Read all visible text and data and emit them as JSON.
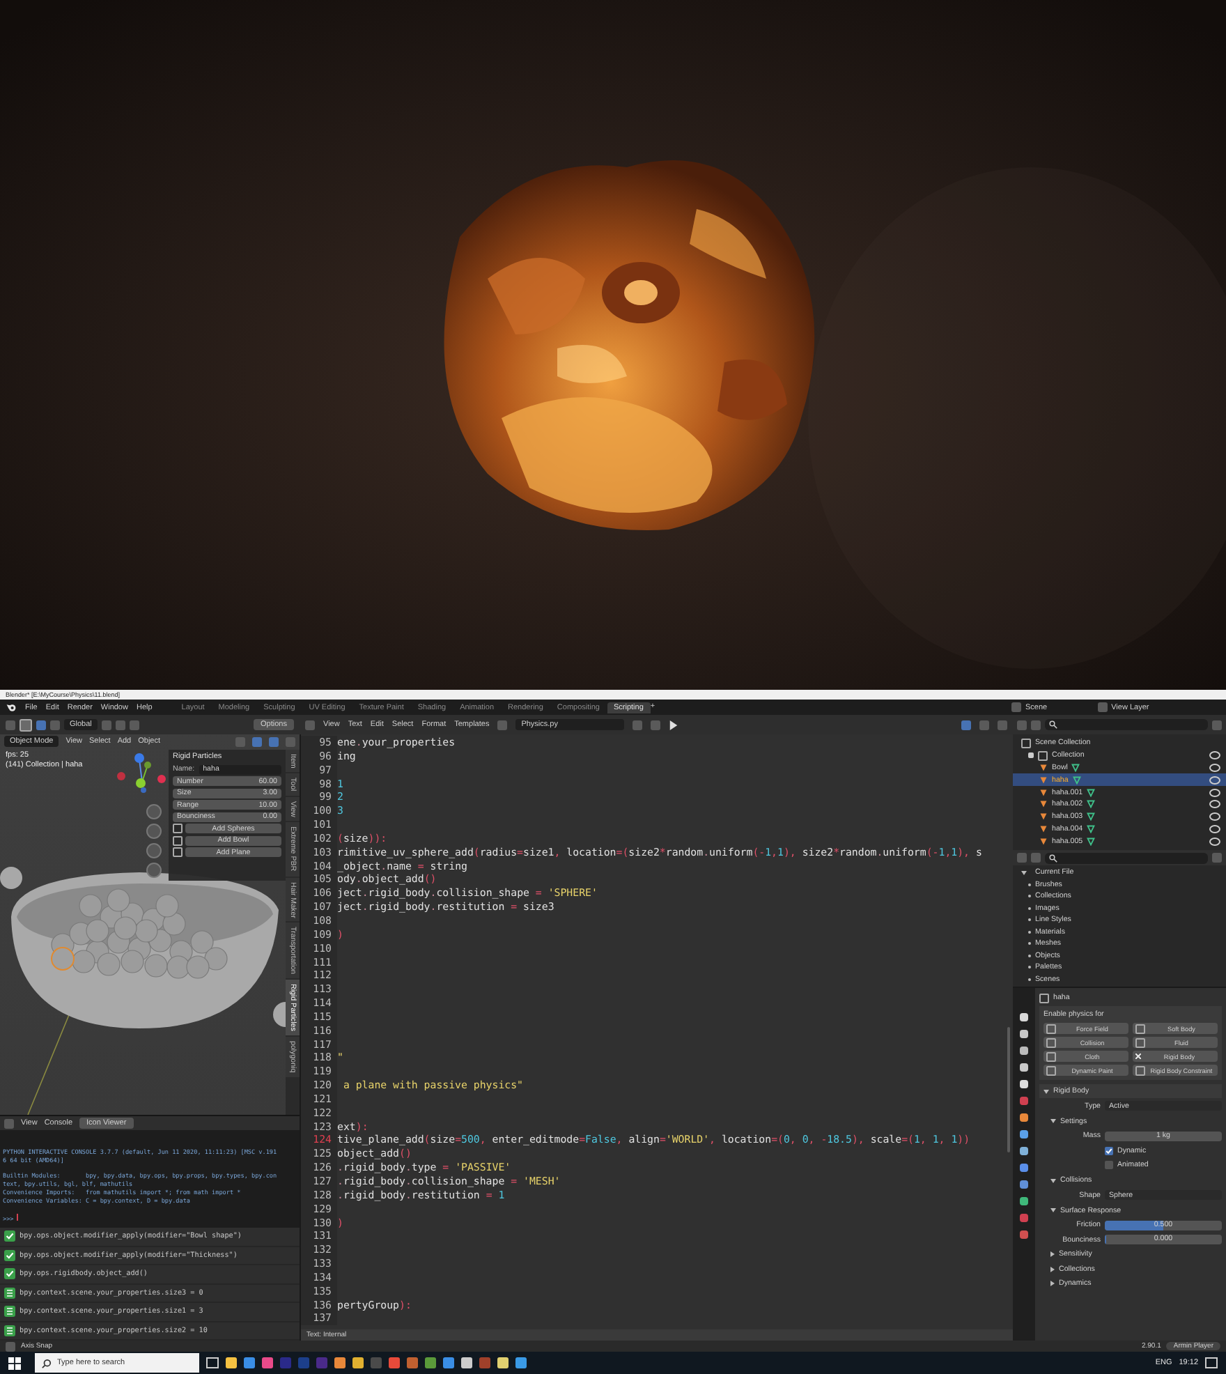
{
  "title_bar": {
    "title": "Blender* [E:\\MyCourse\\Physics\\11.blend]"
  },
  "menu_bar": {
    "menus": [
      "File",
      "Edit",
      "Render",
      "Window",
      "Help"
    ],
    "workspaces": [
      {
        "label": "Layout",
        "selected": false
      },
      {
        "label": "Modeling",
        "selected": false
      },
      {
        "label": "Sculpting",
        "selected": false
      },
      {
        "label": "UV Editing",
        "selected": false
      },
      {
        "label": "Texture Paint",
        "selected": false
      },
      {
        "label": "Shading",
        "selected": false
      },
      {
        "label": "Animation",
        "selected": false
      },
      {
        "label": "Rendering",
        "selected": false
      },
      {
        "label": "Compositing",
        "selected": false
      },
      {
        "label": "Scripting",
        "selected": true
      }
    ],
    "add_tab": "+",
    "scene": "Scene",
    "view_layer": "View Layer"
  },
  "tool_header": {
    "orientation": "Global",
    "options": "Options"
  },
  "viewport": {
    "mode": "Object Mode",
    "menus": [
      "View",
      "Select",
      "Add",
      "Object"
    ],
    "fps": "fps: 25",
    "info": "(141) Collection | haha",
    "panel": {
      "title": "Rigid Particles",
      "name_label": "Name:",
      "name_value": "haha",
      "fields": [
        {
          "label": "Number",
          "value": "60.00"
        },
        {
          "label": "Size",
          "value": "3.00"
        },
        {
          "label": "Range",
          "value": "10.00"
        },
        {
          "label": "Bounciness",
          "value": "0.00"
        }
      ],
      "buttons": [
        "Add Spheres",
        "Add Bowl",
        "Add Plane"
      ]
    },
    "sidebar_tabs": [
      {
        "label": "Item",
        "selected": false
      },
      {
        "label": "Tool",
        "selected": false
      },
      {
        "label": "View",
        "selected": false
      },
      {
        "label": "Extreme PBR",
        "selected": false
      },
      {
        "label": "Hair Maker",
        "selected": false
      },
      {
        "label": "Transportation",
        "selected": false
      },
      {
        "label": "Rigid Particles",
        "selected": true
      },
      {
        "label": "polygoniq",
        "selected": false
      }
    ]
  },
  "console": {
    "menus": [
      "View",
      "Console"
    ],
    "button": "Icon Viewer",
    "output": [
      "PYTHON INTERACTIVE CONSOLE 3.7.7 (default, Jun 11 2020, 11:11:23) [MSC v.191",
      "6 64 bit (AMD64)]",
      "Builtin Modules:       bpy, bpy.data, bpy.ops, bpy.props, bpy.types, bpy.con",
      "text, bpy.utils, bgl, blf, mathutils",
      "Convenience Imports:   from mathutils import *; from math import *",
      "Convenience Variables: C = bpy.context, D = bpy.data"
    ],
    "prompt": ">>>",
    "history": [
      {
        "kind": "operator",
        "text": "bpy.ops.object.modifier_apply(modifier=\"Bowl shape\")"
      },
      {
        "kind": "operator",
        "text": "bpy.ops.object.modifier_apply(modifier=\"Thickness\")"
      },
      {
        "kind": "operator",
        "text": "bpy.ops.rigidbody.object_add()"
      },
      {
        "kind": "property",
        "text": "bpy.context.scene.your_properties.size3 = 0"
      },
      {
        "kind": "property",
        "text": "bpy.context.scene.your_properties.size1 = 3"
      },
      {
        "kind": "property",
        "text": "bpy.context.scene.your_properties.size2 = 10"
      }
    ]
  },
  "text_editor": {
    "menus": [
      "View",
      "Text",
      "Edit",
      "Select",
      "Format",
      "Templates"
    ],
    "file": "Physics.py",
    "footer": "Text: Internal",
    "lines": [
      {
        "number": "95",
        "kind": "code",
        "current": false,
        "text": "ene.your_properties"
      },
      {
        "number": "96",
        "kind": "code",
        "current": false,
        "text": "ing"
      },
      {
        "number": "97",
        "kind": "code",
        "current": false
      },
      {
        "number": "98",
        "kind": "code",
        "current": false,
        "text": "1"
      },
      {
        "number": "99",
        "kind": "code",
        "current": false,
        "text": "2"
      },
      {
        "number": "100",
        "kind": "code",
        "current": false,
        "text": "3"
      },
      {
        "number": "101",
        "kind": "code",
        "current": false
      },
      {
        "number": "102",
        "kind": "code",
        "current": false,
        "text": "(size)):"
      },
      {
        "number": "103",
        "kind": "code",
        "current": false,
        "text": "rimitive_uv_sphere_add(radius=size1, location=(size2*random.uniform(-1,1), size2*random.uniform(-1,1), s"
      },
      {
        "number": "104",
        "kind": "code",
        "current": false,
        "text": "_object.name = string"
      },
      {
        "number": "105",
        "kind": "code",
        "current": false,
        "text": "ody.object_add()"
      },
      {
        "number": "106",
        "kind": "code",
        "current": false,
        "text": "ject.rigid_body.collision_shape = 'SPHERE'"
      },
      {
        "number": "107",
        "kind": "code",
        "current": false,
        "text": "ject.rigid_body.restitution = size3"
      },
      {
        "number": "108",
        "kind": "code",
        "current": false
      },
      {
        "number": "109",
        "kind": "code",
        "current": false,
        "text": ")"
      },
      {
        "number": "110",
        "kind": "code",
        "current": false
      },
      {
        "number": "111",
        "kind": "code",
        "current": false
      },
      {
        "number": "112",
        "kind": "code",
        "current": false
      },
      {
        "number": "113",
        "kind": "code",
        "current": false
      },
      {
        "number": "114",
        "kind": "code",
        "current": false
      },
      {
        "number": "115",
        "kind": "code",
        "current": false
      },
      {
        "number": "116",
        "kind": "code",
        "current": false
      },
      {
        "number": "117",
        "kind": "code",
        "current": false
      },
      {
        "number": "118",
        "kind": "string",
        "current": false,
        "text": "\""
      },
      {
        "number": "119",
        "kind": "code",
        "current": false
      },
      {
        "number": "120",
        "kind": "string",
        "current": false,
        "text": " a plane with passive physics\""
      },
      {
        "number": "121",
        "kind": "code",
        "current": false
      },
      {
        "number": "122",
        "kind": "code",
        "current": false
      },
      {
        "number": "123",
        "kind": "code",
        "current": false,
        "text": "ext):"
      },
      {
        "number": "124",
        "kind": "code",
        "current": true,
        "text": "tive_plane_add(size=500, enter_editmode=False, align='WORLD', location=(0, 0, -18.5), scale=(1, 1, 1))"
      },
      {
        "number": "125",
        "kind": "code",
        "current": false,
        "text": "object_add()"
      },
      {
        "number": "126",
        "kind": "code",
        "current": false,
        "text": ".rigid_body.type = 'PASSIVE'"
      },
      {
        "number": "127",
        "kind": "code",
        "current": false,
        "text": ".rigid_body.collision_shape = 'MESH'"
      },
      {
        "number": "128",
        "kind": "code",
        "current": false,
        "text": ".rigid_body.restitution = 1"
      },
      {
        "number": "129",
        "kind": "code",
        "current": false
      },
      {
        "number": "130",
        "kind": "code",
        "current": false,
        "text": ")"
      },
      {
        "number": "131",
        "kind": "code",
        "current": false
      },
      {
        "number": "132",
        "kind": "code",
        "current": false
      },
      {
        "number": "133",
        "kind": "code",
        "current": false
      },
      {
        "number": "134",
        "kind": "code",
        "current": false
      },
      {
        "number": "135",
        "kind": "code",
        "current": false
      },
      {
        "number": "136",
        "kind": "code",
        "current": false,
        "text": "pertyGroup):"
      },
      {
        "number": "137",
        "kind": "code",
        "current": false
      }
    ]
  },
  "outliner": {
    "root": "Scene Collection",
    "collection": "Collection",
    "items": [
      {
        "name": "Bowl",
        "selected": false
      },
      {
        "name": "haha",
        "selected": true
      },
      {
        "name": "haha.001",
        "selected": false
      },
      {
        "name": "haha.002",
        "selected": false
      },
      {
        "name": "haha.003",
        "selected": false
      },
      {
        "name": "haha.004",
        "selected": false
      },
      {
        "name": "haha.005",
        "selected": false
      }
    ]
  },
  "data_outliner": {
    "root": "Current File",
    "items": [
      "Brushes",
      "Collections",
      "Images",
      "Line Styles",
      "Materials",
      "Meshes",
      "Objects",
      "Palettes",
      "Scenes"
    ]
  },
  "properties": {
    "object": "haha",
    "physics_label": "Enable physics for",
    "physics_buttons": [
      {
        "label": "Force Field",
        "enabled": false
      },
      {
        "label": "Soft Body",
        "enabled": false
      },
      {
        "label": "Collision",
        "enabled": false
      },
      {
        "label": "Fluid",
        "enabled": false
      },
      {
        "label": "Cloth",
        "enabled": false
      },
      {
        "label": "Rigid Body",
        "enabled": true
      },
      {
        "label": "Dynamic Paint",
        "enabled": false
      },
      {
        "label": "Rigid Body Constraint",
        "enabled": false
      }
    ],
    "panel": "Rigid Body",
    "type_label": "Type",
    "type_value": "Active",
    "settings": "Settings",
    "mass_label": "Mass",
    "mass_value": "1 kg",
    "checks": [
      {
        "label": "Dynamic",
        "checked": true
      },
      {
        "label": "Animated",
        "checked": false
      }
    ],
    "collisions": "Collisions",
    "shape_label": "Shape",
    "shape_value": "Sphere",
    "surface": "Surface Response",
    "sliders": [
      {
        "label": "Friction",
        "value": "0.500",
        "level": 0.5
      },
      {
        "label": "Bounciness",
        "value": "0.000",
        "level": 0
      }
    ],
    "closed_panels": [
      "Sensitivity",
      "Collections",
      "Dynamics"
    ]
  },
  "status_bar": {
    "hint": "Axis Snap",
    "version": "2.90.1",
    "user": "Armin Player"
  },
  "taskbar": {
    "search": "Type here to search",
    "language": "ENG",
    "time": "19:12"
  }
}
